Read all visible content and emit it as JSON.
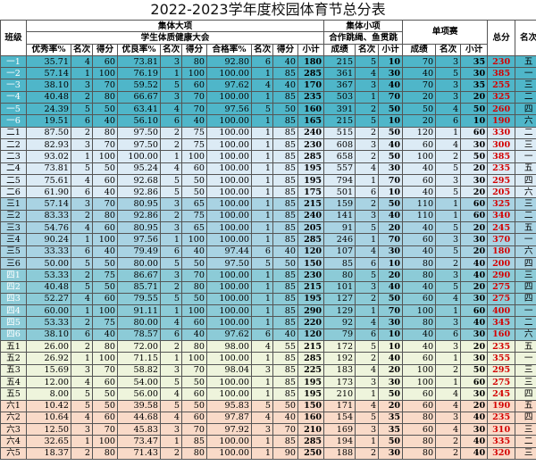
{
  "title": "2022-2023学年度校园体育节总分表",
  "headers": {
    "class": "班级",
    "group_big": "集体大项",
    "group_small": "集体小项",
    "group_single": "单项赛",
    "total": "总分",
    "rank": "名次",
    "fitness": "学生体质健康大会",
    "rope": "合作跳绳、鱼贯跳",
    "cols": [
      "优秀率%",
      "名次",
      "得分",
      "优良率%",
      "名次",
      "得分",
      "合格率%",
      "名次",
      "得分",
      "小计",
      "成绩",
      "名次",
      "小计",
      "成绩",
      "名次",
      "小计"
    ]
  },
  "rows": [
    {
      "cls": "一1",
      "v": [
        "35.71",
        "4",
        "60",
        "73.81",
        "3",
        "80",
        "92.80",
        "6",
        "40",
        "180",
        "215",
        "5",
        "10",
        "70",
        "3",
        "35"
      ],
      "total": "230",
      "rank": "五"
    },
    {
      "cls": "一2",
      "v": [
        "57.14",
        "1",
        "100",
        "76.19",
        "1",
        "100",
        "100.00",
        "1",
        "85",
        "285",
        "361",
        "4",
        "30",
        "40",
        "5",
        "30"
      ],
      "total": "385",
      "rank": "一"
    },
    {
      "cls": "一3",
      "v": [
        "38.10",
        "3",
        "70",
        "59.52",
        "5",
        "60",
        "97.62",
        "4",
        "40",
        "170",
        "367",
        "3",
        "40",
        "70",
        "3",
        "35"
      ],
      "total": "255",
      "rank": "三"
    },
    {
      "cls": "一4",
      "v": [
        "40.48",
        "2",
        "80",
        "66.67",
        "3",
        "70",
        "100.00",
        "1",
        "85",
        "235",
        "503",
        "1",
        "70",
        "20",
        "3",
        "20"
      ],
      "total": "325",
      "rank": "二"
    },
    {
      "cls": "一5",
      "v": [
        "24.39",
        "5",
        "50",
        "63.41",
        "4",
        "70",
        "97.56",
        "5",
        "50",
        "160",
        "391",
        "2",
        "50",
        "50",
        "4",
        "50"
      ],
      "total": "260",
      "rank": "四"
    },
    {
      "cls": "一6",
      "v": [
        "19.51",
        "6",
        "40",
        "56.10",
        "6",
        "40",
        "100.00",
        "1",
        "85",
        "165",
        "215",
        "5",
        "10",
        "20",
        "6",
        "10"
      ],
      "total": "190",
      "rank": "六"
    },
    {
      "cls": "二1",
      "v": [
        "87.50",
        "2",
        "80",
        "97.50",
        "2",
        "75",
        "100.00",
        "1",
        "85",
        "240",
        "515",
        "2",
        "50",
        "120",
        "1",
        "60"
      ],
      "total": "330",
      "rank": "二"
    },
    {
      "cls": "二2",
      "v": [
        "82.93",
        "3",
        "70",
        "97.50",
        "2",
        "75",
        "100.00",
        "1",
        "85",
        "230",
        "608",
        "3",
        "40",
        "60",
        "4",
        "30"
      ],
      "total": "300",
      "rank": "三"
    },
    {
      "cls": "二3",
      "v": [
        "93.02",
        "1",
        "100",
        "100.00",
        "1",
        "100",
        "100.00",
        "1",
        "85",
        "285",
        "658",
        "2",
        "50",
        "100",
        "2",
        "50"
      ],
      "total": "385",
      "rank": "一"
    },
    {
      "cls": "二4",
      "v": [
        "73.81",
        "5",
        "50",
        "95.24",
        "4",
        "60",
        "100.00",
        "1",
        "85",
        "195",
        "557",
        "4",
        "30",
        "40",
        "5",
        "20"
      ],
      "total": "235",
      "rank": "五"
    },
    {
      "cls": "二5",
      "v": [
        "75.61",
        "4",
        "60",
        "92.68",
        "5",
        "50",
        "100.00",
        "1",
        "85",
        "195",
        "794",
        "1",
        "70",
        "60",
        "3",
        "30"
      ],
      "total": "295",
      "rank": "四"
    },
    {
      "cls": "二6",
      "v": [
        "61.90",
        "6",
        "40",
        "92.86",
        "5",
        "50",
        "100.00",
        "1",
        "85",
        "175",
        "501",
        "6",
        "10",
        "40",
        "5",
        "20"
      ],
      "total": "205",
      "rank": "六"
    },
    {
      "cls": "三1",
      "v": [
        "57.14",
        "3",
        "70",
        "80.95",
        "3",
        "65",
        "100.00",
        "1",
        "85",
        "215",
        "159",
        "2",
        "50",
        "110",
        "1",
        "60"
      ],
      "total": "325",
      "rank": "三"
    },
    {
      "cls": "三2",
      "v": [
        "83.33",
        "2",
        "80",
        "92.86",
        "2",
        "75",
        "100.00",
        "1",
        "85",
        "240",
        "141",
        "3",
        "40",
        "110",
        "1",
        "60"
      ],
      "total": "340",
      "rank": "二"
    },
    {
      "cls": "三3",
      "v": [
        "54.76",
        "4",
        "60",
        "80.95",
        "3",
        "65",
        "100.00",
        "1",
        "85",
        "205",
        "91",
        "5",
        "20",
        "40",
        "5",
        "20"
      ],
      "total": "245",
      "rank": "五"
    },
    {
      "cls": "三4",
      "v": [
        "90.24",
        "1",
        "100",
        "97.56",
        "1",
        "100",
        "100.00",
        "1",
        "85",
        "285",
        "246",
        "1",
        "70",
        "60",
        "3",
        "30"
      ],
      "total": "370",
      "rank": "一"
    },
    {
      "cls": "三5",
      "v": [
        "33.33",
        "6",
        "40",
        "79.49",
        "6",
        "40",
        "97.44",
        "6",
        "40",
        "120",
        "107",
        "4",
        "30",
        "40",
        "5",
        "20"
      ],
      "total": "180",
      "rank": "六"
    },
    {
      "cls": "三6",
      "v": [
        "50.00",
        "5",
        "50",
        "80.00",
        "5",
        "50",
        "97.50",
        "5",
        "50",
        "150",
        "85",
        "6",
        "10",
        "80",
        "2",
        "40"
      ],
      "total": "200",
      "rank": "四"
    },
    {
      "cls": "四1",
      "v": [
        "53.33",
        "2",
        "75",
        "86.67",
        "3",
        "70",
        "100.00",
        "1",
        "85",
        "230",
        "80",
        "5",
        "20",
        "80",
        "3",
        "40"
      ],
      "total": "290",
      "rank": "三"
    },
    {
      "cls": "四2",
      "v": [
        "40.48",
        "5",
        "50",
        "85.71",
        "2",
        "80",
        "100.00",
        "1",
        "85",
        "215",
        "101",
        "3",
        "40",
        "40",
        "5",
        "20"
      ],
      "total": "275",
      "rank": "四"
    },
    {
      "cls": "四3",
      "v": [
        "52.27",
        "4",
        "60",
        "79.55",
        "5",
        "50",
        "100.00",
        "1",
        "85",
        "195",
        "127",
        "2",
        "50",
        "60",
        "4",
        "30"
      ],
      "total": "275",
      "rank": "四"
    },
    {
      "cls": "四4",
      "v": [
        "60.00",
        "1",
        "100",
        "91.11",
        "1",
        "100",
        "100.00",
        "1",
        "85",
        "290",
        "129",
        "1",
        "70",
        "100",
        "1",
        "60"
      ],
      "total": "400",
      "rank": "一"
    },
    {
      "cls": "四5",
      "v": [
        "53.33",
        "2",
        "75",
        "80.00",
        "4",
        "60",
        "100.00",
        "1",
        "85",
        "220",
        "92",
        "4",
        "30",
        "80",
        "3",
        "40"
      ],
      "total": "345",
      "rank": "二"
    },
    {
      "cls": "四6",
      "v": [
        "38.10",
        "6",
        "40",
        "78.57",
        "6",
        "40",
        "97.62",
        "6",
        "40",
        "120",
        "79",
        "6",
        "10",
        "40",
        "6",
        "30"
      ],
      "total": "160",
      "rank": "六"
    },
    {
      "cls": "五1",
      "v": [
        "26.00",
        "2",
        "80",
        "72.00",
        "2",
        "80",
        "98.00",
        "4",
        "55",
        "215",
        "172",
        "5",
        "10",
        "40",
        "3",
        "20"
      ],
      "total": "235",
      "rank": "五"
    },
    {
      "cls": "五2",
      "v": [
        "26.92",
        "1",
        "100",
        "71.15",
        "1",
        "100",
        "100.00",
        "1",
        "85",
        "285",
        "192",
        "2",
        "40",
        "60",
        "1",
        "30"
      ],
      "total": "355",
      "rank": "一"
    },
    {
      "cls": "五3",
      "v": [
        "15.69",
        "3",
        "70",
        "58.82",
        "3",
        "70",
        "98.04",
        "3",
        "85",
        "225",
        "183",
        "4",
        "20",
        "100",
        "2",
        "50"
      ],
      "total": "295",
      "rank": "三"
    },
    {
      "cls": "五4",
      "v": [
        "12.00",
        "4",
        "60",
        "54.00",
        "5",
        "50",
        "100.00",
        "1",
        "85",
        "195",
        "173",
        "3",
        "30",
        "100",
        "1",
        "60"
      ],
      "total": "275",
      "rank": "三"
    },
    {
      "cls": "五5",
      "v": [
        "8.00",
        "5",
        "50",
        "56.00",
        "4",
        "60",
        "100.00",
        "1",
        "85",
        "195",
        "210",
        "1",
        "50",
        "60",
        "4",
        "30"
      ],
      "total": "245",
      "rank": "四"
    },
    {
      "cls": "六1",
      "v": [
        "10.42",
        "5",
        "50",
        "39.58",
        "5",
        "50",
        "95.83",
        "5",
        "50",
        "150",
        "171",
        "4",
        "20",
        "60",
        "4",
        "20"
      ],
      "total": "190",
      "rank": "五"
    },
    {
      "cls": "六2",
      "v": [
        "10.64",
        "4",
        "60",
        "44.68",
        "4",
        "60",
        "97.87",
        "4",
        "40",
        "160",
        "154",
        "5",
        "35",
        "80",
        "3",
        "40"
      ],
      "total": "235",
      "rank": "四"
    },
    {
      "cls": "六3",
      "v": [
        "12.50",
        "3",
        "70",
        "45.83",
        "3",
        "70",
        "97.92",
        "3",
        "70",
        "210",
        "169",
        "3",
        "35",
        "60",
        "4",
        "30"
      ],
      "total": "310",
      "rank": "三"
    },
    {
      "cls": "六4",
      "v": [
        "32.65",
        "1",
        "100",
        "73.47",
        "1",
        "85",
        "100.00",
        "1",
        "85",
        "285",
        "194",
        "1",
        "50",
        "80",
        "2",
        "40"
      ],
      "total": "335",
      "rank": "二"
    },
    {
      "cls": "六5",
      "v": [
        "18.37",
        "2",
        "80",
        "71.43",
        "2",
        "80",
        "100.00",
        "1",
        "90",
        "250",
        "188",
        "2",
        "30",
        "80",
        "2",
        "40"
      ],
      "total": "320",
      "rank": "三"
    }
  ]
}
